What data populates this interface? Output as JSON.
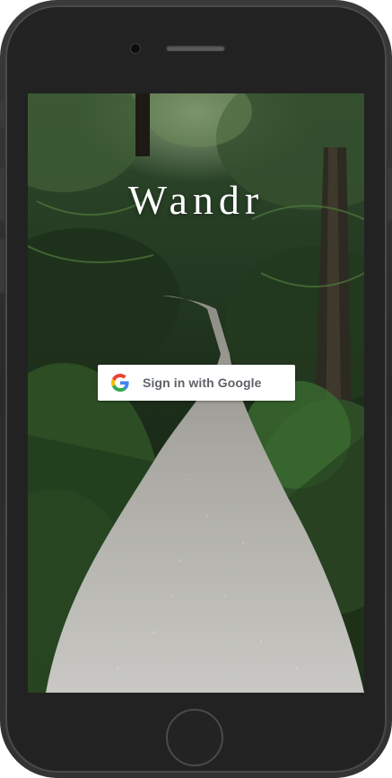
{
  "app": {
    "title": "Wandr"
  },
  "signin": {
    "label": "Sign in with Google",
    "icon": "google-g-icon"
  },
  "colors": {
    "button_bg": "#ffffff",
    "button_text": "#5f6368",
    "google_blue": "#4285F4",
    "google_red": "#EA4335",
    "google_yellow": "#FBBC05",
    "google_green": "#34A853"
  }
}
